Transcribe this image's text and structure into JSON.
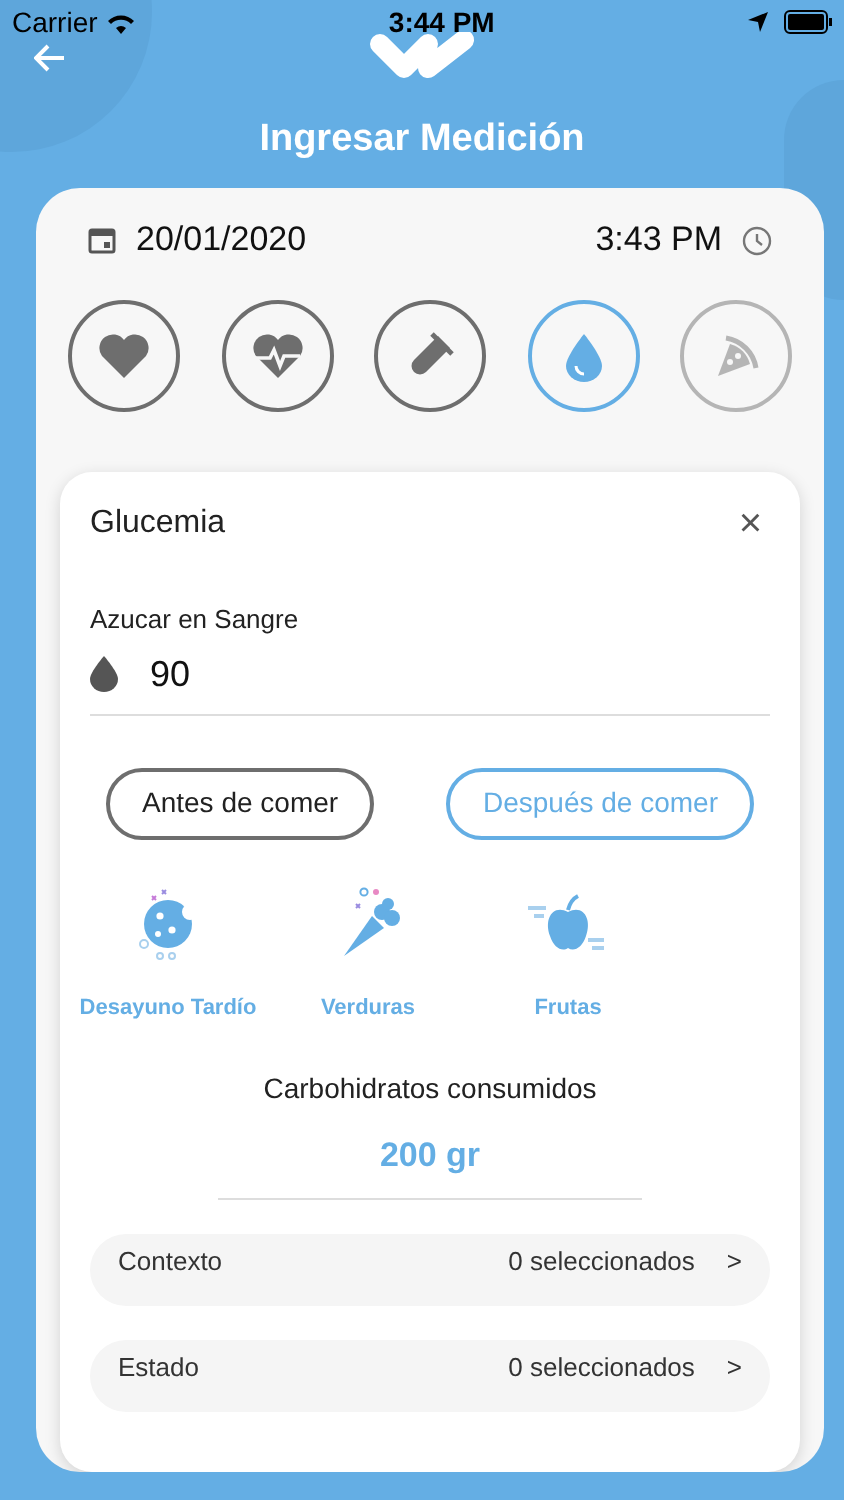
{
  "status_bar": {
    "carrier": "Carrier",
    "time": "3:44 PM"
  },
  "header": {
    "title": "Ingresar Medición"
  },
  "datetime": {
    "date": "20/01/2020",
    "time": "3:43 PM"
  },
  "categories": [
    {
      "kind": "heart",
      "selected": false,
      "disabled": false
    },
    {
      "kind": "heartbeat",
      "selected": false,
      "disabled": false
    },
    {
      "kind": "test-tube",
      "selected": false,
      "disabled": false
    },
    {
      "kind": "drop",
      "selected": true,
      "disabled": false
    },
    {
      "kind": "pizza",
      "selected": false,
      "disabled": true
    }
  ],
  "form": {
    "title": "Glucemia",
    "close": "×",
    "field_label": "Azucar en Sangre",
    "value": "90",
    "meal_times": [
      {
        "label": "Antes de comer",
        "selected": false
      },
      {
        "label": "Después de comer",
        "selected": true
      }
    ],
    "foods": [
      {
        "kind": "cookie",
        "label": "Desayuno Tardío"
      },
      {
        "kind": "carrot",
        "label": "Verduras"
      },
      {
        "kind": "apple",
        "label": "Frutas"
      }
    ],
    "carbs_label": "Carbohidratos consumidos",
    "carbs_value": "200 gr",
    "selectors": [
      {
        "label": "Contexto",
        "value": "0 seleccionados",
        "chevron": ">"
      },
      {
        "label": "Estado",
        "value": "0 seleccionados",
        "chevron": ">"
      }
    ]
  }
}
